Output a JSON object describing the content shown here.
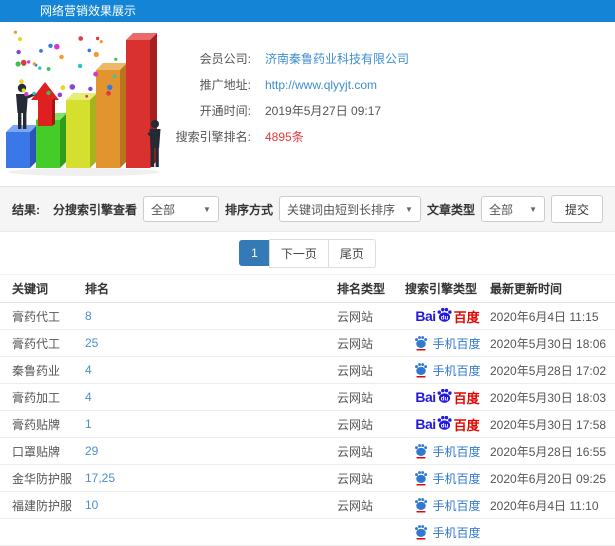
{
  "window": {
    "title": "网络营销效果展示"
  },
  "info": {
    "fields": [
      {
        "label": "会员公司:",
        "value": "济南秦鲁药业科技有限公司",
        "style": "link"
      },
      {
        "label": "推广地址:",
        "value": "http://www.qlyyjt.com",
        "style": "link"
      },
      {
        "label": "开通时间:",
        "value": "2019年5月27日 09:17",
        "style": "plain"
      },
      {
        "label": "搜索引擎排名:",
        "value": "4895条",
        "style": "red"
      }
    ]
  },
  "filters": {
    "section_label": "结果:",
    "groups": [
      {
        "label": "分搜索引擎查看",
        "value": "全部"
      },
      {
        "label": "排序方式",
        "value": "关键词由短到长排序"
      },
      {
        "label": "文章类型",
        "value": "全部"
      }
    ],
    "submit": "提交"
  },
  "pagination": {
    "pages": [
      "1"
    ],
    "next": "下一页",
    "last": "尾页"
  },
  "table": {
    "headers": [
      "关键词",
      "排名",
      "排名类型",
      "搜索引擎类型",
      "最新更新时间"
    ],
    "rows": [
      {
        "keyword": "膏药代工",
        "rank": "8",
        "rank_type": "云网站",
        "engine": "baidu_pc",
        "updated": "2020年6月4日 11:15"
      },
      {
        "keyword": "膏药代工",
        "rank": "25",
        "rank_type": "云网站",
        "engine": "baidu_mobile",
        "updated": "2020年5月30日 18:06"
      },
      {
        "keyword": "秦鲁药业",
        "rank": "4",
        "rank_type": "云网站",
        "engine": "baidu_mobile",
        "updated": "2020年5月28日 17:02"
      },
      {
        "keyword": "膏药加工",
        "rank": "4",
        "rank_type": "云网站",
        "engine": "baidu_pc",
        "updated": "2020年5月30日 18:03"
      },
      {
        "keyword": "膏药贴牌",
        "rank": "1",
        "rank_type": "云网站",
        "engine": "baidu_pc",
        "updated": "2020年5月30日 17:58"
      },
      {
        "keyword": "口罩贴牌",
        "rank": "29",
        "rank_type": "云网站",
        "engine": "baidu_mobile",
        "updated": "2020年5月28日 16:55"
      },
      {
        "keyword": "金华防护服",
        "rank": "17,25",
        "rank_type": "云网站",
        "engine": "baidu_mobile",
        "updated": "2020年6月20日 09:25"
      },
      {
        "keyword": "福建防护服",
        "rank": "10",
        "rank_type": "云网站",
        "engine": "baidu_mobile",
        "updated": "2020年6月4日 11:10"
      },
      {
        "keyword": "",
        "rank": "",
        "rank_type": "",
        "engine": "baidu_mobile",
        "updated": ""
      }
    ]
  },
  "engines": {
    "baidu_pc": {
      "text_bai": "Bai",
      "text_du": "du",
      "text_cn": "百度"
    },
    "baidu_mobile": {
      "text": "手机百度"
    }
  },
  "colors": {
    "header_bg": "#1484d6",
    "link_blue": "#3e8ed0",
    "highlight_red": "#e4393c",
    "baidu_blue": "#2319dc",
    "baidu_red": "#e10602",
    "mobile_blue": "#3079d1",
    "pagination_active": "#337ab7"
  }
}
